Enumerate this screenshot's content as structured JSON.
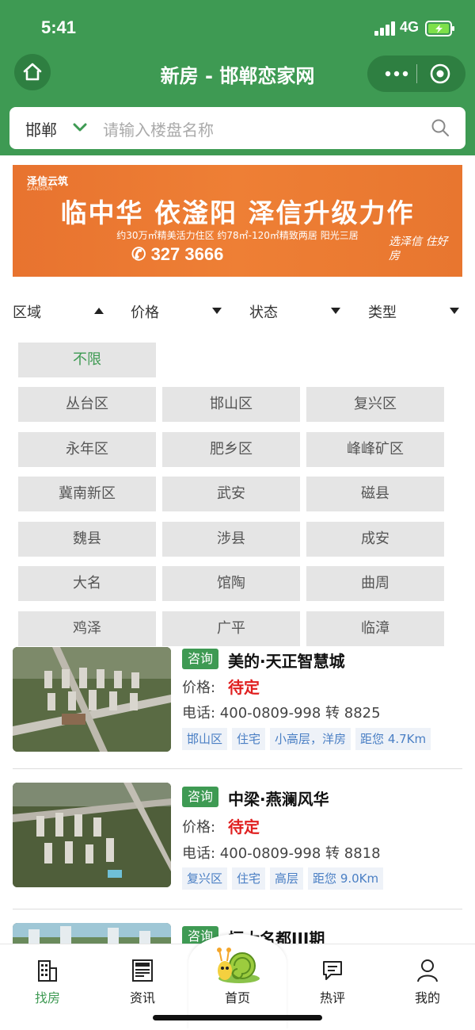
{
  "status_bar": {
    "time": "5:41",
    "network": "4G"
  },
  "nav": {
    "title": "新房 - 邯郸恋家网"
  },
  "search": {
    "city": "邯郸",
    "placeholder": "请输入楼盘名称"
  },
  "banner": {
    "brand": "泽信云筑",
    "brand_sub": "ZANSION",
    "headline": "临中华 依滏阳 泽信升级力作",
    "subline": "约30万㎡精美活力住区 约78㎡-120㎡精致两居 阳光三居",
    "phone": "327 3666",
    "slogan": "选泽信 住好房"
  },
  "filters": [
    {
      "label": "区域",
      "arrow": "up"
    },
    {
      "label": "价格",
      "arrow": "down"
    },
    {
      "label": "状态",
      "arrow": "down"
    },
    {
      "label": "类型",
      "arrow": "down"
    }
  ],
  "regions": {
    "selected": "不限",
    "items": [
      "丛台区",
      "邯山区",
      "复兴区",
      "永年区",
      "肥乡区",
      "峰峰矿区",
      "冀南新区",
      "武安",
      "磁县",
      "魏县",
      "涉县",
      "成安",
      "大名",
      "馆陶",
      "曲周",
      "鸡泽",
      "广平",
      "临漳"
    ]
  },
  "listings": [
    {
      "consult": "咨询",
      "name": "美的·天正智慧城",
      "price_label": "价格:",
      "price": "待定",
      "phone": "电话: 400-0809-998 转 8825",
      "tags": [
        "邯山区",
        "住宅",
        "小高层，洋房",
        "距您 4.7Km"
      ]
    },
    {
      "consult": "咨询",
      "name": "中梁·燕澜风华",
      "price_label": "价格:",
      "price": "待定",
      "phone": "电话: 400-0809-998 转 8818",
      "tags": [
        "复兴区",
        "住宅",
        "高层",
        "距您 9.0Km"
      ]
    },
    {
      "consult": "咨询",
      "name": "恒大名都III期"
    }
  ],
  "tabbar": {
    "items": [
      "找房",
      "资讯",
      "首页",
      "热评",
      "我的"
    ],
    "active": "找房"
  },
  "colors": {
    "brand_green": "#3e9a53",
    "price_red": "#e02020",
    "tag_blue": "#4a7fc4",
    "banner_orange": "#ee7f35"
  }
}
